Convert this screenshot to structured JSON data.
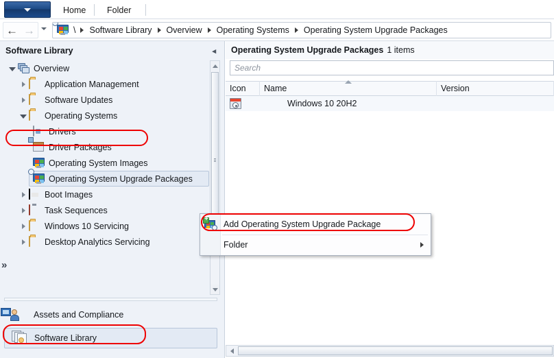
{
  "ribbon": {
    "app_button_icon": "chevron-down-icon",
    "tabs": [
      {
        "label": "Home"
      },
      {
        "label": "Folder"
      }
    ]
  },
  "address_bar": {
    "back_icon": "back-arrow-icon",
    "forward_icon": "forward-arrow-icon",
    "history_dropdown_icon": "chevron-down-icon",
    "location_icon": "console-icon",
    "root_separator": "\\",
    "breadcrumbs": [
      {
        "label": "Software Library"
      },
      {
        "label": "Overview"
      },
      {
        "label": "Operating Systems"
      },
      {
        "label": "Operating System Upgrade Packages"
      }
    ]
  },
  "left_panel": {
    "title": "Software Library",
    "collapse_icon": "chevron-left-icon",
    "overflow_indicator": "»",
    "tree": [
      {
        "label": "Overview",
        "icon": "overview-stack-icon",
        "indent": 0,
        "twisty": "expanded",
        "selected": false
      },
      {
        "label": "Application Management",
        "icon": "folder-icon",
        "indent": 1,
        "twisty": "collapsed",
        "selected": false
      },
      {
        "label": "Software Updates",
        "icon": "folder-icon",
        "indent": 1,
        "twisty": "collapsed",
        "selected": false
      },
      {
        "label": "Operating Systems",
        "icon": "folder-icon",
        "indent": 1,
        "twisty": "expanded",
        "selected": false
      },
      {
        "label": "Drivers",
        "icon": "driver-doc-icon",
        "indent": 2,
        "twisty": "none",
        "selected": false
      },
      {
        "label": "Driver Packages",
        "icon": "driver-package-icon",
        "indent": 2,
        "twisty": "none",
        "selected": false
      },
      {
        "label": "Operating System Images",
        "icon": "os-image-monitor-icon",
        "indent": 2,
        "twisty": "none",
        "selected": false
      },
      {
        "label": "Operating System Upgrade Packages",
        "icon": "os-upgrade-package-icon",
        "indent": 2,
        "twisty": "none",
        "selected": true
      },
      {
        "label": "Boot Images",
        "icon": "boot-image-icon",
        "indent": 2,
        "twisty": "collapsed",
        "selected": false
      },
      {
        "label": "Task Sequences",
        "icon": "task-sequence-icon",
        "indent": 2,
        "twisty": "collapsed",
        "selected": false
      },
      {
        "label": "Windows 10 Servicing",
        "icon": "folder-icon",
        "indent": 1,
        "twisty": "collapsed",
        "selected": false
      },
      {
        "label": "Desktop Analytics Servicing",
        "icon": "folder-icon",
        "indent": 1,
        "twisty": "collapsed",
        "selected": false
      }
    ],
    "workspaces": [
      {
        "label": "Assets and Compliance",
        "icon": "assets-compliance-icon",
        "selected": false
      },
      {
        "label": "Software Library",
        "icon": "software-library-icon",
        "selected": true
      }
    ]
  },
  "content": {
    "header_title": "Operating System Upgrade Packages",
    "header_count": "1 items",
    "search": {
      "placeholder": "Search",
      "value": ""
    },
    "columns": [
      {
        "label": "Icon",
        "sorted": false
      },
      {
        "label": "Name",
        "sorted": true,
        "sort_direction": "ascending"
      },
      {
        "label": "Version",
        "sorted": false
      }
    ],
    "rows": [
      {
        "icon": "media-package-icon",
        "name": "Windows 10 20H2",
        "version": ""
      }
    ]
  },
  "context_menu": {
    "items": [
      {
        "label": "Add Operating System Upgrade Package",
        "icon": "add-os-upgrade-package-icon",
        "submenu": false,
        "highlighted": true
      },
      {
        "label": "Folder",
        "icon": "",
        "submenu": true,
        "highlighted": false
      }
    ]
  },
  "annotations": {
    "color": "#ee0000",
    "boxes": [
      {
        "target": "tree-item-operating-systems"
      },
      {
        "target": "context-menu-add-os-upgrade-package"
      },
      {
        "target": "workspace-software-library"
      }
    ]
  }
}
